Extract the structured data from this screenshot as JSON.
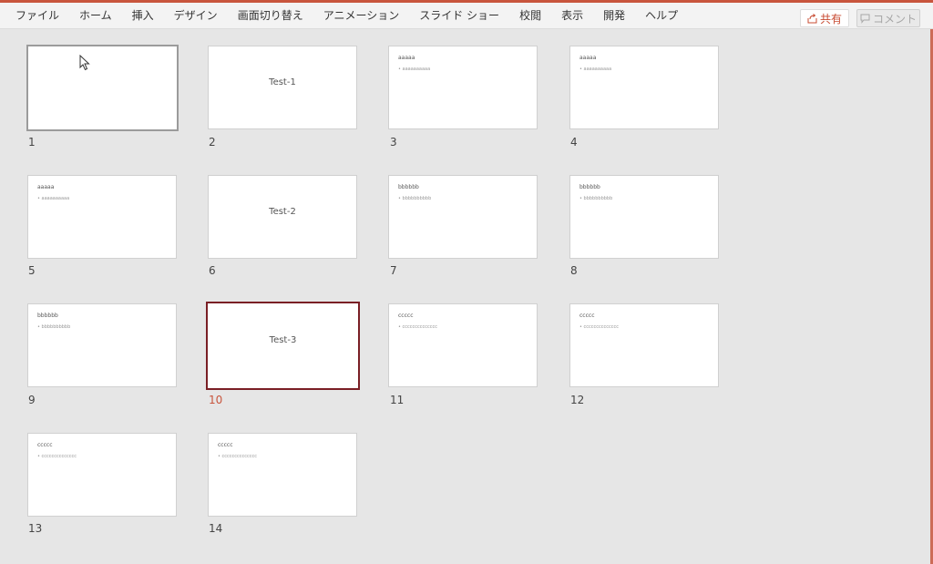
{
  "ribbon": {
    "tabs": [
      "ファイル",
      "ホーム",
      "挿入",
      "デザイン",
      "画面切り替え",
      "アニメーション",
      "スライド ショー",
      "校閲",
      "表示",
      "開発",
      "ヘルプ"
    ],
    "share_label": "共有",
    "comment_label": "コメント"
  },
  "slides": [
    {
      "num": "1",
      "title": "",
      "heading": "",
      "bullet": ""
    },
    {
      "num": "2",
      "title": "Test-1",
      "heading": "",
      "bullet": ""
    },
    {
      "num": "3",
      "title": "",
      "heading": "aaaaa",
      "bullet": "• aaaaaaaaaa"
    },
    {
      "num": "4",
      "title": "",
      "heading": "aaaaa",
      "bullet": "• aaaaaaaaaa"
    },
    {
      "num": "5",
      "title": "",
      "heading": "aaaaa",
      "bullet": "• aaaaaaaaaa"
    },
    {
      "num": "6",
      "title": "Test-2",
      "heading": "",
      "bullet": ""
    },
    {
      "num": "7",
      "title": "",
      "heading": "bbbbbb",
      "bullet": "• bbbbbbbbbb"
    },
    {
      "num": "8",
      "title": "",
      "heading": "bbbbbb",
      "bullet": "• bbbbbbbbbb"
    },
    {
      "num": "9",
      "title": "",
      "heading": "bbbbbb",
      "bullet": "• bbbbbbbbbb"
    },
    {
      "num": "10",
      "title": "Test-3",
      "heading": "",
      "bullet": ""
    },
    {
      "num": "11",
      "title": "",
      "heading": "ccccc",
      "bullet": "• cccccccccccccc"
    },
    {
      "num": "12",
      "title": "",
      "heading": "ccccc",
      "bullet": "• cccccccccccccc"
    },
    {
      "num": "13",
      "title": "",
      "heading": "ccccc",
      "bullet": "• cccccccccccccc"
    },
    {
      "num": "14",
      "title": "",
      "heading": "ccccc",
      "bullet": "• cccccccccccccc"
    }
  ],
  "colors": {
    "accent": "#c8553d",
    "selected_border": "#7a1f25",
    "background": "#e6e6e6"
  }
}
